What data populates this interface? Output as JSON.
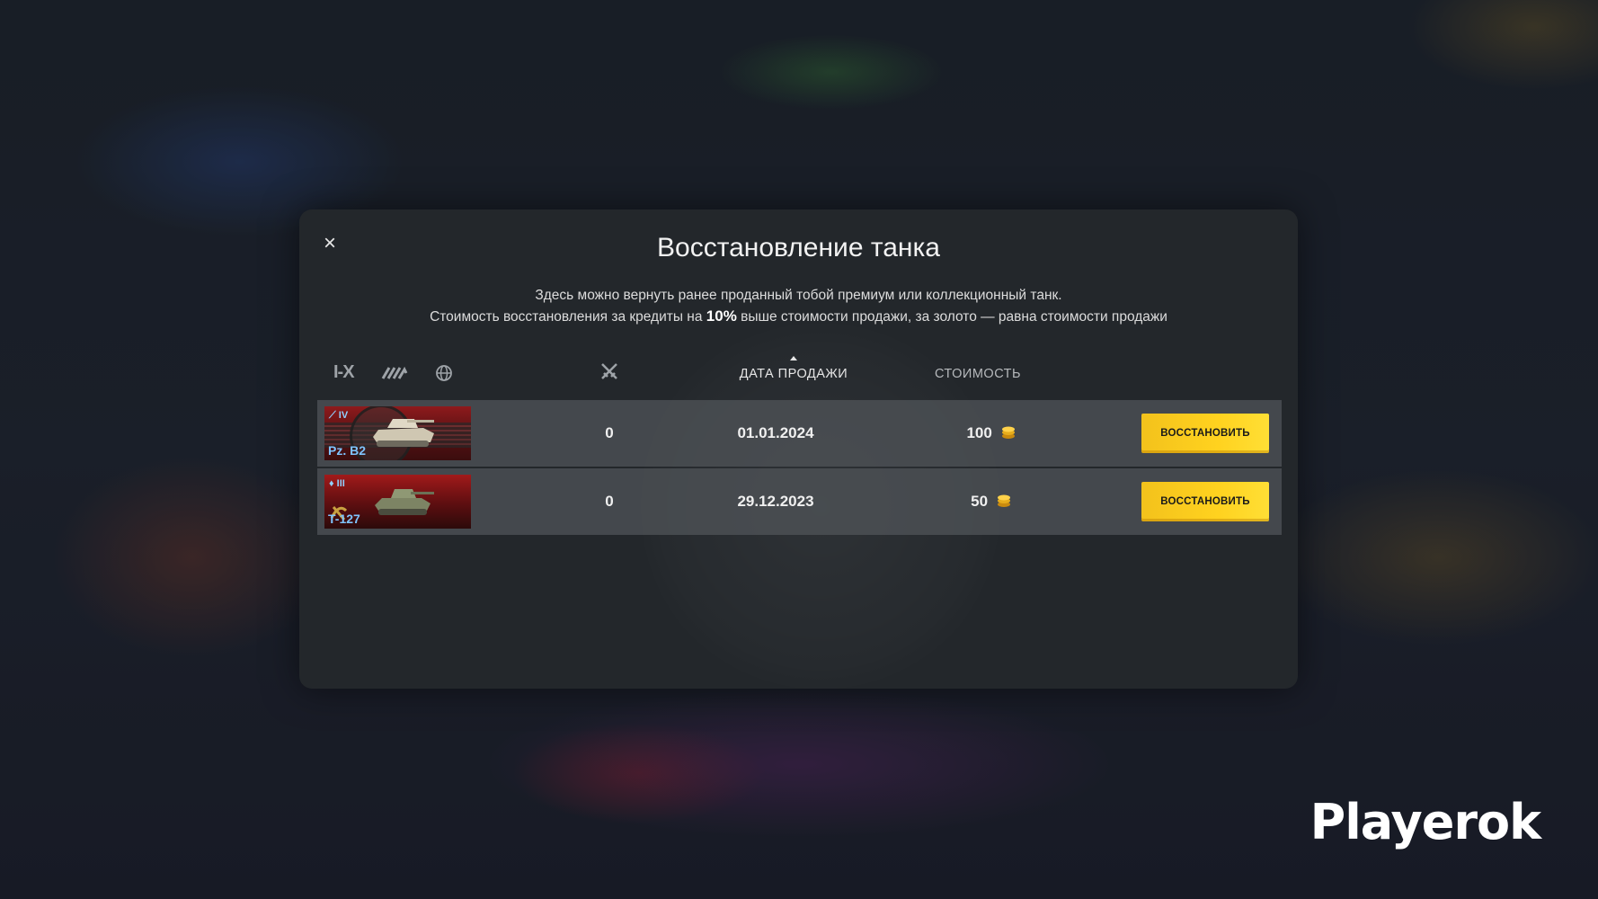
{
  "modal": {
    "title": "Восстановление танка",
    "description_line1": "Здесь можно вернуть ранее проданный тобой премиум или коллекционный танк.",
    "description_line2_prefix": "Стоимость восстановления за кредиты на",
    "description_line2_highlight": "10%",
    "description_line2_suffix": "выше стоимости продажи, за золото — равна стоимости продажи",
    "close_icon": "×"
  },
  "filters": {
    "tier_label": "I-X",
    "type_icon": "tank-type-icon",
    "nation_icon": "globe-icon"
  },
  "columns": {
    "battles_icon": "crossed-swords-icon",
    "date_label": "ДАТА ПРОДАЖИ",
    "cost_label": "СТОИМОСТЬ",
    "sort_direction": "ascending"
  },
  "rows": [
    {
      "tank_name": "Pz. B2",
      "tier": "IV",
      "nation": "germany",
      "battles": "0",
      "date": "01.01.2024",
      "cost": "100",
      "currency_icon": "gold-coin-icon",
      "button_label": "ВОССТАНОВИТЬ"
    },
    {
      "tank_name": "T-127",
      "tier": "III",
      "nation": "ussr",
      "battles": "0",
      "date": "29.12.2023",
      "cost": "50",
      "currency_icon": "gold-coin-icon",
      "button_label": "ВОССТАНОВИТЬ"
    }
  ],
  "watermark": "Playerok",
  "colors": {
    "accent_button": "#ffd21f",
    "tank_name": "#7fc4ff",
    "modal_bg": "#23272b"
  }
}
